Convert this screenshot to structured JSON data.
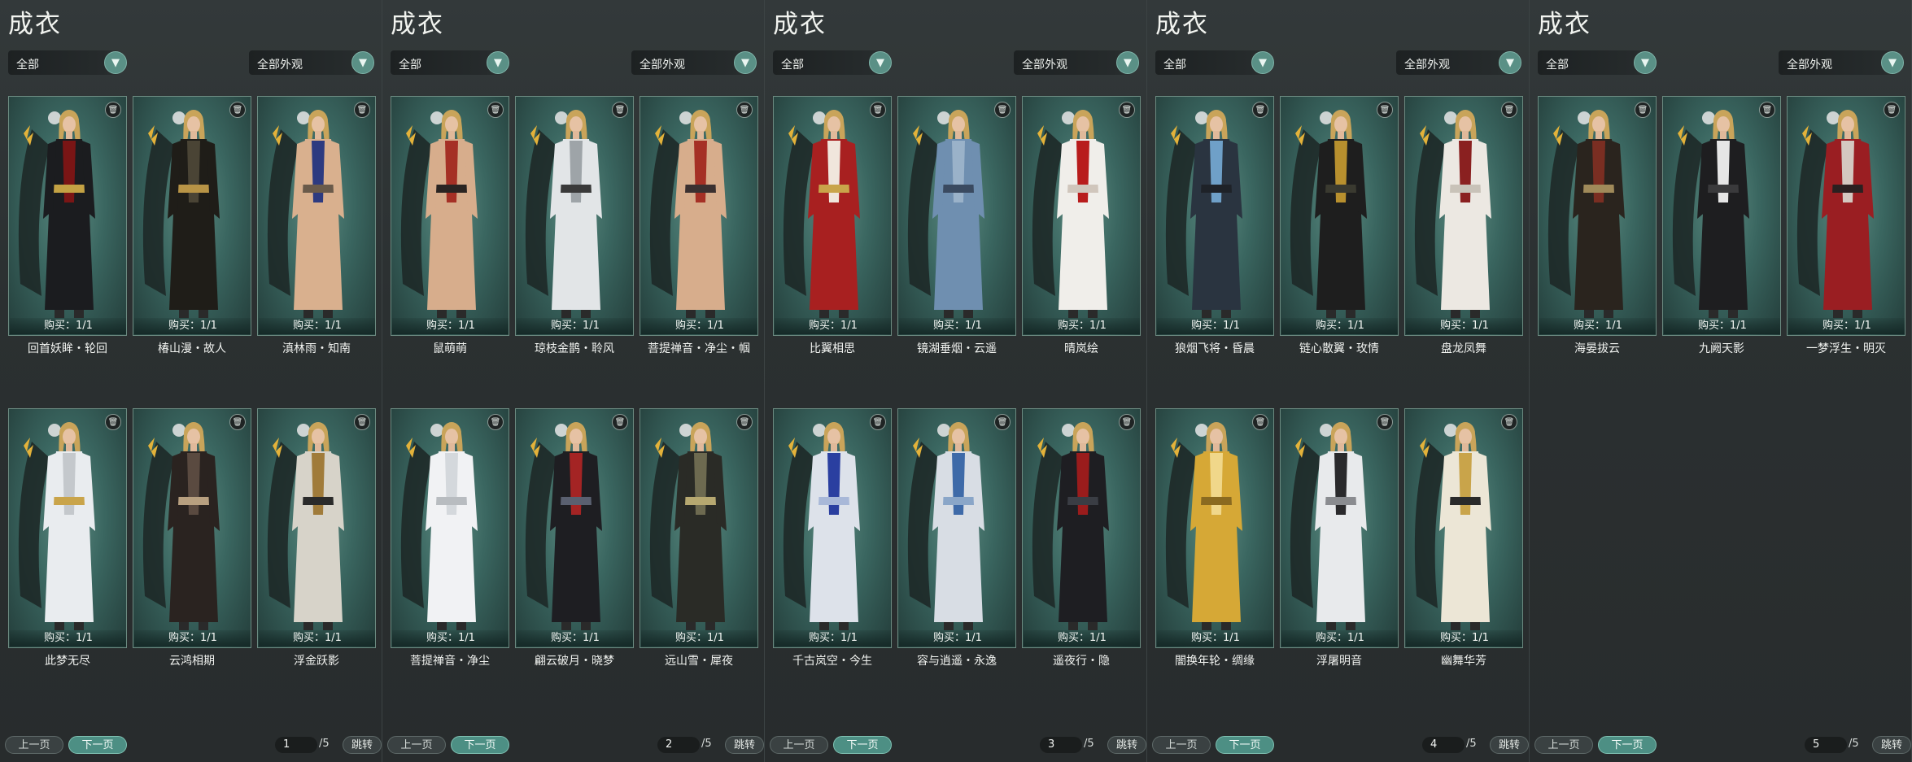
{
  "labels": {
    "title": "成衣",
    "category_filter": "全部",
    "look_filter": "全部外观",
    "buy_prefix": "购买：",
    "prev": "上一页",
    "next": "下一页",
    "jump": "跳转",
    "total_pages": "/5"
  },
  "icons": {
    "dropdown": "chevron-down-icon",
    "trash": "trash-icon"
  },
  "panels": [
    {
      "page": "1",
      "items": [
        {
          "name": "回首妖眸・轮回",
          "buy": "1/1",
          "colors": [
            "#1b1c1f",
            "#7a1515",
            "#c4a244"
          ]
        },
        {
          "name": "椿山漫・故人",
          "buy": "1/1",
          "colors": [
            "#1f1d18",
            "#4a4435",
            "#b89446"
          ]
        },
        {
          "name": "滇林雨・知南",
          "buy": "1/1",
          "colors": [
            "#d9b08e",
            "#2d3a80",
            "#6a5a4a"
          ]
        },
        {
          "name": "此梦无尽",
          "buy": "1/1",
          "colors": [
            "#e9ecef",
            "#c4c8cc",
            "#c9a44a"
          ]
        },
        {
          "name": "云鸿相期",
          "buy": "1/1",
          "colors": [
            "#2a2320",
            "#5a4a40",
            "#b8a080"
          ]
        },
        {
          "name": "浮金跃影",
          "buy": "1/1",
          "colors": [
            "#d7d3c9",
            "#a07b3a",
            "#2a2a2a"
          ]
        }
      ]
    },
    {
      "page": "2",
      "items": [
        {
          "name": "鼠萌萌",
          "buy": "1/1",
          "colors": [
            "#d7ad8c",
            "#a53025",
            "#2a2422"
          ]
        },
        {
          "name": "琼枝金鹊・聆风",
          "buy": "1/1",
          "colors": [
            "#e2e5e7",
            "#9ea4a8",
            "#3a3a3a"
          ]
        },
        {
          "name": "菩提禅音・净尘・帼",
          "buy": "1/1",
          "colors": [
            "#d7ad8c",
            "#a53025",
            "#3a3030"
          ]
        },
        {
          "name": "菩提禅音・净尘",
          "buy": "1/1",
          "colors": [
            "#f1f2f4",
            "#d4d8dc",
            "#b8bcc0"
          ]
        },
        {
          "name": "翩云破月・晓梦",
          "buy": "1/1",
          "colors": [
            "#1e1e22",
            "#a42424",
            "#5a6070"
          ]
        },
        {
          "name": "远山雪・犀夜",
          "buy": "1/1",
          "colors": [
            "#2a2b26",
            "#6d6a50",
            "#b6a870"
          ]
        }
      ]
    },
    {
      "page": "3",
      "items": [
        {
          "name": "比翼相思",
          "buy": "1/1",
          "colors": [
            "#a82020",
            "#f0e6dc",
            "#c9a44a"
          ]
        },
        {
          "name": "镜湖垂烟・云遥",
          "buy": "1/1",
          "colors": [
            "#6f8fb0",
            "#9ab2c9",
            "#3a4a60"
          ]
        },
        {
          "name": "晴岚绘",
          "buy": "1/1",
          "colors": [
            "#f0eeea",
            "#b81c1c",
            "#d0c6bc"
          ]
        },
        {
          "name": "千古岚空・今生",
          "buy": "1/1",
          "colors": [
            "#dde2ea",
            "#2a3fa0",
            "#a8b8d8"
          ]
        },
        {
          "name": "容与逍遥・永逸",
          "buy": "1/1",
          "colors": [
            "#d8dde4",
            "#3e6aa8",
            "#8aa6c8"
          ]
        },
        {
          "name": "遥夜行・隐",
          "buy": "1/1",
          "colors": [
            "#1e1e22",
            "#9a1c1c",
            "#3a3d44"
          ]
        }
      ]
    },
    {
      "page": "4",
      "items": [
        {
          "name": "狼烟飞将・昏晨",
          "buy": "1/1",
          "colors": [
            "#2a3440",
            "#6fa0c8",
            "#1e2228"
          ]
        },
        {
          "name": "链心散翼・玫情",
          "buy": "1/1",
          "colors": [
            "#1e1e1e",
            "#b8902e",
            "#3a3a30"
          ]
        },
        {
          "name": "盘龙凤舞",
          "buy": "1/1",
          "colors": [
            "#ece8e2",
            "#8a2020",
            "#c8c2b8"
          ]
        },
        {
          "name": "闇换年轮・绸缘",
          "buy": "1/1",
          "colors": [
            "#d6a836",
            "#f0d78a",
            "#8a6a20"
          ]
        },
        {
          "name": "浮屠明音",
          "buy": "1/1",
          "colors": [
            "#e8eaec",
            "#2a2a2c",
            "#8a8c90"
          ]
        },
        {
          "name": "幽舞华芳",
          "buy": "1/1",
          "colors": [
            "#ece6d6",
            "#c9a44a",
            "#2a2a2a"
          ]
        }
      ]
    },
    {
      "page": "5",
      "items": [
        {
          "name": "海晏拔云",
          "buy": "1/1",
          "colors": [
            "#2a241e",
            "#7a2e22",
            "#a08a5a"
          ]
        },
        {
          "name": "九阙天影",
          "buy": "1/1",
          "colors": [
            "#1e1e20",
            "#e6e6e6",
            "#3a3a3c"
          ]
        },
        {
          "name": "一梦浮生・明灭",
          "buy": "1/1",
          "colors": [
            "#9a1e22",
            "#d4c8c0",
            "#2a2020"
          ]
        }
      ]
    }
  ]
}
